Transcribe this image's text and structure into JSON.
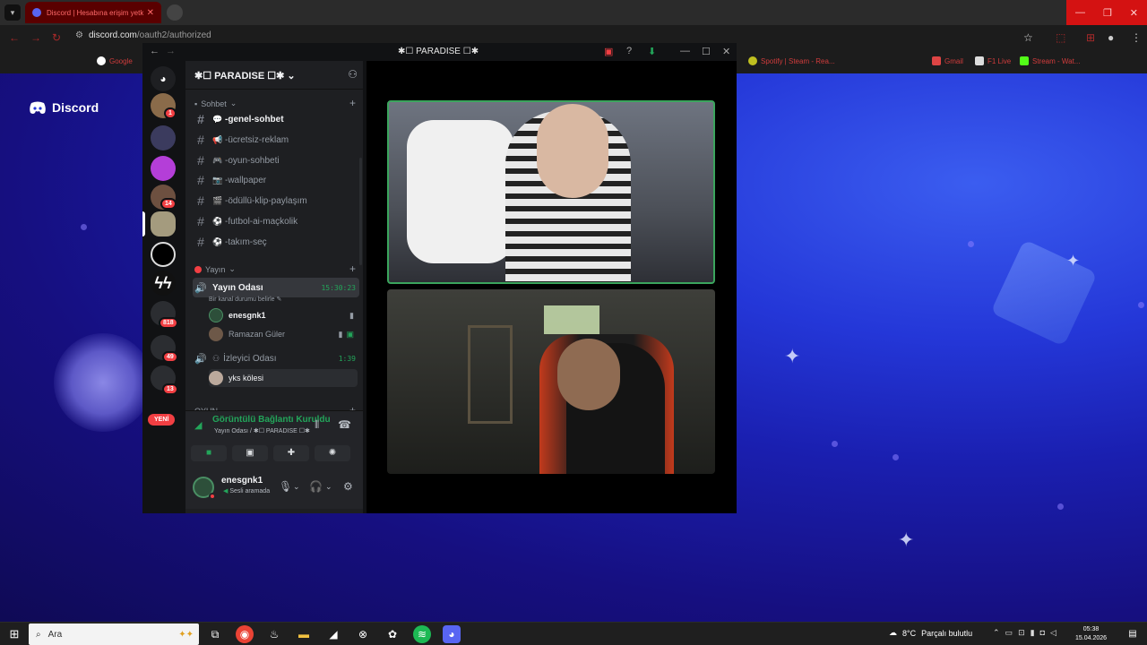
{
  "browser": {
    "tab_title": "Discord | Hesabına erişim yetki...",
    "tab_close": "✕",
    "url_host": "discord.com",
    "url_path": "/oauth2/authorized",
    "bookmarks": [
      {
        "label": "Google",
        "icon": "google-icon"
      },
      {
        "label": "Spotify | Steam - Rea...",
        "icon": "spotify-icon"
      },
      {
        "label": "Gmail",
        "icon": "gmail-icon"
      },
      {
        "label": "F1 Live",
        "icon": "f1-icon"
      },
      {
        "label": "Stream - Wat...",
        "icon": "kick-icon"
      }
    ]
  },
  "page": {
    "brand": "Discord"
  },
  "discord": {
    "window_title": "✱☐ PARADISE ☐✱",
    "guild_name": "✱☐ PARADISE ☐✱",
    "categories": {
      "sohbet": "Sohbet",
      "yayin": "Yayın",
      "oyun": "OYUN"
    },
    "channels": [
      {
        "name": "-genel-sohbet",
        "emoji": "💬"
      },
      {
        "name": "-ücretsiz-reklam",
        "emoji": "📢"
      },
      {
        "name": "-oyun-sohbeti",
        "emoji": "🎮"
      },
      {
        "name": "-wallpaper",
        "emoji": "📷"
      },
      {
        "name": "-ödüllü-klip-paylaşım",
        "emoji": "🎬"
      },
      {
        "name": "-futbol-ai-maçkolik",
        "emoji": "⚽"
      },
      {
        "name": "-takım-seç",
        "emoji": "⚽"
      }
    ],
    "voice_channels": [
      {
        "name": "Yayın Odası",
        "time": "15:30:23",
        "status": "Bir kanal durumu belirle ✎",
        "users": [
          {
            "name": "enesgnk1"
          },
          {
            "name": "Ramazan Güler"
          }
        ]
      },
      {
        "name": "İzleyici Odası",
        "time": "1:39",
        "users": [
          {
            "name": "yks kölesi"
          }
        ]
      }
    ],
    "server_badges": [
      "1",
      "14",
      "818",
      "49",
      "13"
    ],
    "new_label": "YENİ",
    "voice_panel": {
      "status": "Görüntülü Bağlantı Kuruldu",
      "location": "Yayın Odası / ✱☐ PARADISE ☐✱"
    },
    "user": {
      "name": "enesgnk1",
      "status": "Sesli aramada"
    }
  },
  "taskbar": {
    "search_placeholder": "Ara",
    "temperature": "8°C",
    "weather": "Parçalı bulutlu",
    "time": "05:38",
    "date": "15.04.2026"
  },
  "colors": {
    "online_green": "#23a55a",
    "badge_red": "#f23f43",
    "discord_bg": "#1e1f22"
  }
}
